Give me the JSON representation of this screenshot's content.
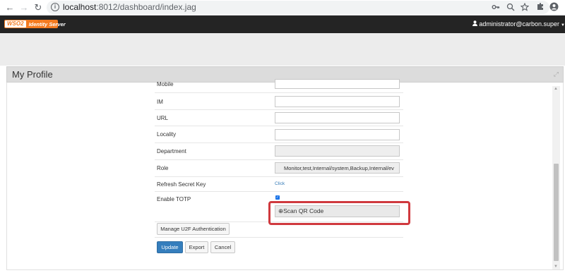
{
  "browser": {
    "back_glyph": "←",
    "forward_glyph": "→",
    "reload_glyph": "↻",
    "url_host": "localhost",
    "url_path": ":8012/dashboard/index.jag",
    "icons": [
      "key-icon",
      "zoom-icon",
      "star-icon",
      "extensions-icon",
      "profile-icon"
    ]
  },
  "app": {
    "logo_mark": "WSO2",
    "logo_text": "Identity Server",
    "user": "administrator@carbon.super",
    "accent_color": "#f47b20"
  },
  "panel": {
    "title": "My Profile"
  },
  "form": {
    "rows": [
      {
        "label": "Mobile",
        "value": ""
      },
      {
        "label": "IM",
        "value": ""
      },
      {
        "label": "URL",
        "value": ""
      },
      {
        "label": "Locality",
        "value": ""
      },
      {
        "label": "Department",
        "value": ""
      },
      {
        "label": "Role",
        "value": "Monitor,test,Internal/system,Backup,Internal/ev"
      },
      {
        "label": "Refresh Secret Key",
        "link": "Click"
      },
      {
        "label": "Enable TOTP",
        "checked": true
      }
    ],
    "qr_button": "⊕Scan QR Code",
    "u2f_button": "Manage U2F Authentication",
    "update_button": "Update",
    "export_button": "Export",
    "cancel_button": "Cancel"
  },
  "highlight_color": "#d0393e"
}
